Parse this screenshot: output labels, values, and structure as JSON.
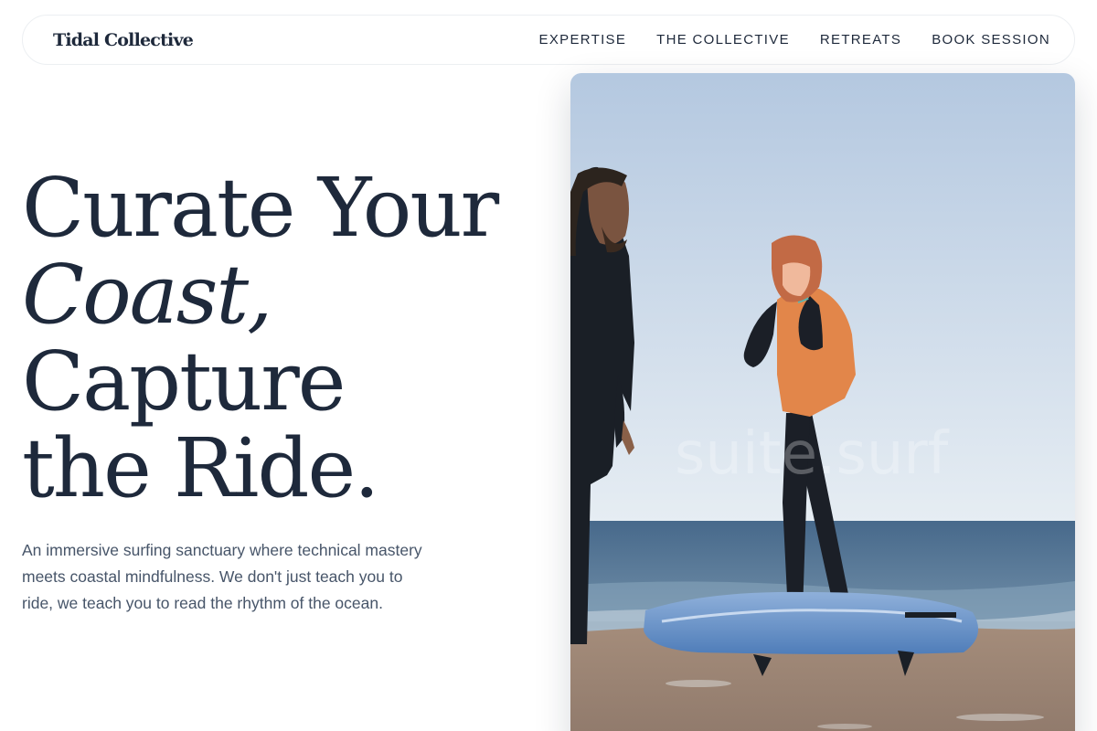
{
  "brand": {
    "name": "Tidal Collective"
  },
  "nav": {
    "links": [
      {
        "label": "EXPERTISE"
      },
      {
        "label": "THE COLLECTIVE"
      },
      {
        "label": "RETREATS"
      },
      {
        "label": "BOOK SESSION"
      }
    ]
  },
  "hero": {
    "title_line1": "Curate Your",
    "title_line2_italic": "Coast,",
    "title_line3": "Capture",
    "title_line4": "the Ride.",
    "subtitle": "An immersive surfing sanctuary where technical mastery meets coastal mindfulness. We don't just teach you to ride, we teach you to read the rhythm of the ocean."
  },
  "photo": {
    "watermark": "suite.surf",
    "icon": "surf-instructors-photo"
  },
  "colors": {
    "text_dark": "#1e293b",
    "text_muted": "#475569",
    "sky": "#b9cde3",
    "ocean": "#5d7d99",
    "sand": "#9d8676",
    "board": "#5b86c2",
    "rashguard": "#e6894b"
  }
}
